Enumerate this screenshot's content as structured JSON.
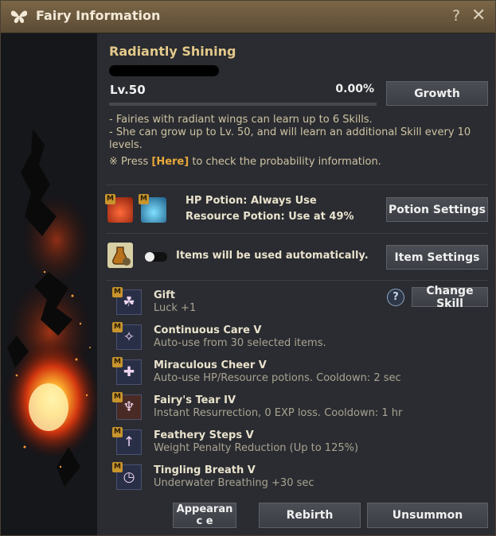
{
  "window": {
    "title": "Fairy Information",
    "help_label": "?",
    "close_label": "✕"
  },
  "fairy": {
    "name": "Radiantly Shining",
    "level": "Lv.50",
    "exp_percent": "0.00%",
    "exp_fraction": 0
  },
  "buttons": {
    "growth": "Growth",
    "potion_settings": "Potion Settings",
    "item_settings": "Item Settings",
    "change_skill": "Change Skill",
    "appearance": "Appearanc e",
    "rebirth": "Rebirth",
    "unsummon": "Unsummon"
  },
  "description": {
    "line1": "- Fairies with radiant wings can learn up to 6 Skills.",
    "line2": "- She can grow up to Lv. 50, and will learn an additional Skill every 10 levels.",
    "note_prefix": "※ Press ",
    "note_link": "[Here]",
    "note_suffix": " to check the probability information."
  },
  "potions": {
    "badge": "M",
    "hp": "HP Potion: Always Use",
    "resource": "Resource Potion: Use at 49%"
  },
  "auto_items": {
    "label": "Items will be used automatically.",
    "enabled": false
  },
  "skills": [
    {
      "badge": "M",
      "icon": "clover-icon",
      "glyph": "☘",
      "name": "Gift",
      "desc": "Luck +1"
    },
    {
      "badge": "M",
      "icon": "fairy-icon",
      "glyph": "✧",
      "name": "Continuous Care V",
      "desc": "Auto-use from 30 selected items."
    },
    {
      "badge": "M",
      "icon": "potion-cheer-icon",
      "glyph": "✚",
      "name": "Miraculous Cheer V",
      "desc": "Auto-use HP/Resource potions. Cooldown: 2 sec"
    },
    {
      "badge": "M",
      "icon": "tear-icon",
      "glyph": "♆",
      "name": "Fairy's Tear IV",
      "desc": "Instant Resurrection, 0 EXP loss. Cooldown: 1 hr"
    },
    {
      "badge": "M",
      "icon": "feather-weight-icon",
      "glyph": "↑",
      "name": "Feathery Steps V",
      "desc": "Weight Penalty Reduction (Up to 125%)"
    },
    {
      "badge": "M",
      "icon": "breath-icon",
      "glyph": "◷",
      "name": "Tingling Breath V",
      "desc": "Underwater Breathing +30 sec"
    }
  ],
  "skill_help_label": "?"
}
